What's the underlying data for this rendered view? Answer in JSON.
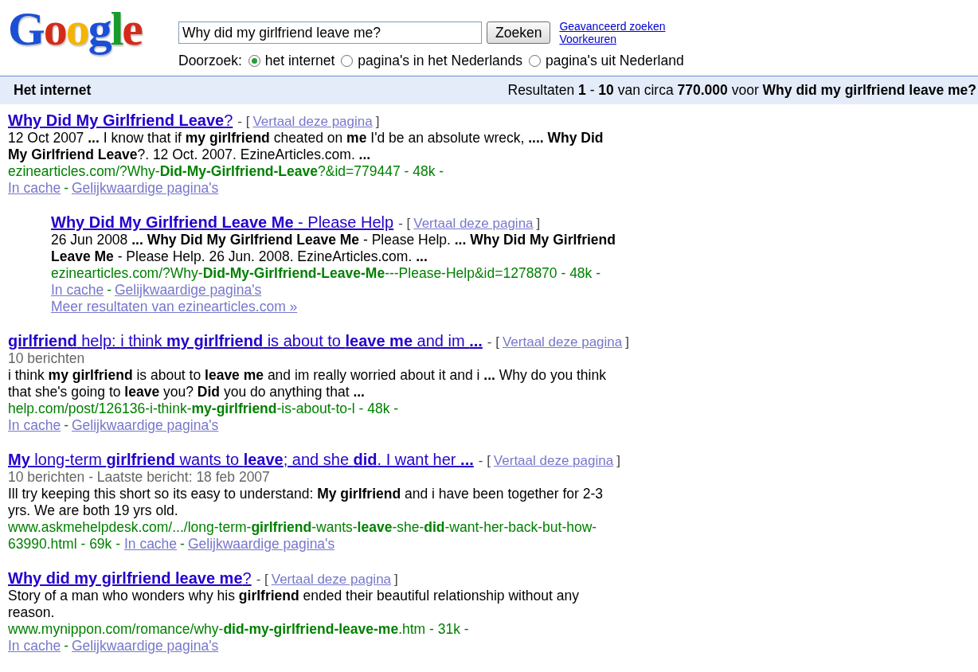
{
  "logo": {
    "text": "Google"
  },
  "search": {
    "value": "Why did my girlfriend leave me?",
    "button": "Zoeken",
    "links": [
      "Geavanceerd zoeken",
      "Voorkeuren"
    ]
  },
  "scope": {
    "label": "Doorzoek:",
    "options": [
      {
        "label": "het internet",
        "selected": true
      },
      {
        "label": "pagina's in het Nederlands",
        "selected": false
      },
      {
        "label": "pagina's uit Nederland",
        "selected": false
      }
    ]
  },
  "results_bar": {
    "title": "Het internet",
    "summary": "Resultaten **1** - **10** van circa **770.000** voor **Why did my girlfriend leave me?**"
  },
  "results": [
    {
      "indented": false,
      "title": "**Why Did My Girlfriend Leave**?",
      "translate": {
        "open": "- [",
        "label": "Vertaal deze pagina",
        "close": "]"
      },
      "snippet": "12 Oct 2007 **...** I know that if **my girlfriend** cheated on **me** I'd be an absolute wreck, **.... Why Did My Girlfriend Leave**?. 12 Oct. 2007. EzineArticles.com. **...**",
      "url": "ezinearticles.com/?Why-**Did-My-Girlfriend-Leave**?&id=779447 - 48k -",
      "links_on_url_line": false,
      "cache": "In cache",
      "separator": "-",
      "similar": "Gelijkwaardige pagina's"
    },
    {
      "indented": true,
      "title": "**Why Did My Girlfriend Leave Me** - Please Help",
      "translate": {
        "open": "- [",
        "label": "Vertaal deze pagina",
        "close": "]"
      },
      "snippet": "26 Jun 2008 **... Why Did My Girlfriend Leave Me** - Please Help. **... Why Did My Girlfriend Leave Me** - Please Help. 26 Jun. 2008. EzineArticles.com. **...**",
      "url": "ezinearticles.com/?Why-**Did-My-Girlfriend-Leave-Me**---Please-Help&id=1278870 - 48k -",
      "links_on_url_line": false,
      "cache": "In cache",
      "separator": "-",
      "similar": "Gelijkwaardige pagina's",
      "more": "Meer resultaten van ezinearticles.com »"
    },
    {
      "indented": false,
      "title": "**girlfriend** help: i think **my girlfriend** is about to **leave me** and im **...**",
      "translate": {
        "open": "- [",
        "label": "Vertaal deze pagina",
        "close": "]"
      },
      "meta": "10 berichten",
      "snippet": "i think **my girlfriend** is about to **leave me** and im really worried about it and i **...** Why do you think that she's going to **leave** you? **Did** you do anything that **...**",
      "url": "help.com/post/126136-i-think-**my-girlfriend**-is-about-to-l - 48k -",
      "links_on_url_line": false,
      "cache": "In cache",
      "separator": "-",
      "similar": "Gelijkwaardige pagina's"
    },
    {
      "indented": false,
      "title": "**My** long-term **girlfriend** wants to **leave**; and she **did**. I want her **...**",
      "translate": {
        "open": "- [",
        "label": "Vertaal deze pagina",
        "close": "]"
      },
      "meta": "10 berichten - Laatste bericht: 18 feb 2007",
      "snippet": "Ill try keeping this short so its easy to understand: **My girlfriend** and i have been together for 2-3 yrs. We are both 19 yrs old.",
      "url": "www.askmehelpdesk.com/.../long-term-**girlfriend**-wants-**leave**-she-**did**-want-her-back-but-how-63990.html - 69k -",
      "links_on_url_line": true,
      "cache": "In cache",
      "separator": "-",
      "similar": "Gelijkwaardige pagina's"
    },
    {
      "indented": false,
      "title": "**Why did my girlfriend leave me**?",
      "translate": {
        "open": "- [",
        "label": "Vertaal deze pagina",
        "close": "]"
      },
      "snippet": "Story of a man who wonders why his **girlfriend** ended their beautiful relationship without any reason.",
      "url": "www.mynippon.com/romance/why-**did-my-girlfriend-leave-me**.htm - 31k -",
      "links_on_url_line": false,
      "cache": "In cache",
      "separator": "-",
      "similar": "Gelijkwaardige pagina's"
    }
  ]
}
